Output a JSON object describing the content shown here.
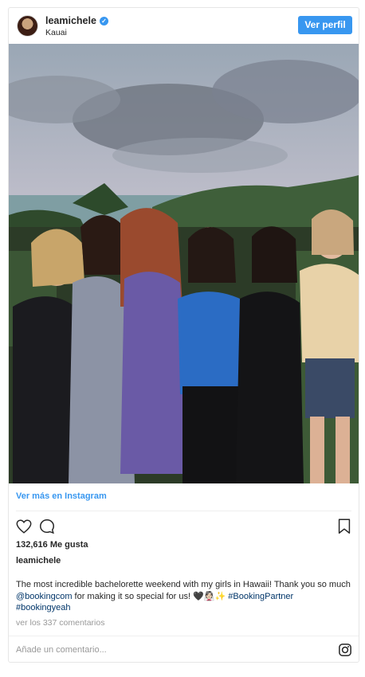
{
  "header": {
    "username": "leamichele",
    "location": "Kauai",
    "profile_button": "Ver perfil"
  },
  "footer": {
    "more_link": "Ver más en Instagram",
    "likes": "132,616 Me gusta",
    "caption_user": "leamichele",
    "caption_text_1": "The most incredible bachelorette weekend with my girls in Hawaii! Thank you so much ",
    "caption_mention": "@bookingcom",
    "caption_text_2": " for making it so special for us! 🖤👰🏻✨ ",
    "caption_hashtag_1": "#BookingPartner",
    "caption_hashtag_2": "#bookingyeah",
    "comments_link": "ver los 337 comentarios",
    "comment_placeholder": "Añade un comentario..."
  },
  "icons": [
    "verified-icon",
    "heart-icon",
    "comment-bubble-icon",
    "bookmark-icon",
    "instagram-icon"
  ],
  "colors": {
    "accent": "#3897f0",
    "hashtag": "#003569",
    "muted": "#999999"
  }
}
